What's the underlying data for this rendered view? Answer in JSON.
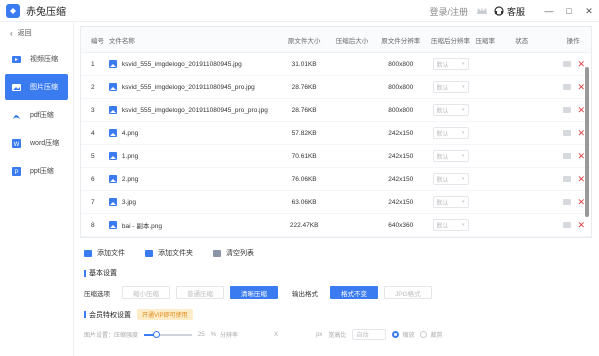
{
  "app": {
    "title": "赤兔压缩",
    "login": "登录/注册",
    "service": "客服"
  },
  "window_buttons": [
    "—",
    "□",
    "✕"
  ],
  "sidebar": {
    "back": "返回",
    "items": [
      {
        "label": "视频压缩",
        "icon": "video-icon"
      },
      {
        "label": "图片压缩",
        "icon": "image-icon",
        "active": true
      },
      {
        "label": "pdf压缩",
        "icon": "pdf-icon"
      },
      {
        "label": "word压缩",
        "icon": "word-icon"
      },
      {
        "label": "ppt压缩",
        "icon": "ppt-icon"
      }
    ]
  },
  "table": {
    "headers": {
      "no": "编号",
      "name": "文件名称",
      "size": "原文件大小",
      "csize": "压缩后大小",
      "res": "原文件分辨率",
      "cres": "压缩后分辨率",
      "ratio": "压缩率",
      "status": "状态",
      "op": "操作"
    },
    "rows": [
      {
        "no": "1",
        "name": "ksvid_555_imgdelogo_201911080945.jpg",
        "size": "31.01KB",
        "res": "800x800",
        "cres": "默认"
      },
      {
        "no": "2",
        "name": "ksvid_555_imgdelogo_201911080945_pro.jpg",
        "size": "28.76KB",
        "res": "800x800",
        "cres": "默认"
      },
      {
        "no": "3",
        "name": "ksvid_555_imgdelogo_201911080945_pro_pro.jpg",
        "size": "28.76KB",
        "res": "800x800",
        "cres": "默认"
      },
      {
        "no": "4",
        "name": "4.png",
        "size": "57.82KB",
        "res": "242x150",
        "cres": "默认"
      },
      {
        "no": "5",
        "name": "1.png",
        "size": "70.61KB",
        "res": "242x150",
        "cres": "默认"
      },
      {
        "no": "6",
        "name": "2.png",
        "size": "76.06KB",
        "res": "242x150",
        "cres": "默认"
      },
      {
        "no": "7",
        "name": "3.jpg",
        "size": "63.06KB",
        "res": "242x150",
        "cres": "默认"
      },
      {
        "no": "8",
        "name": "bai - 副本.png",
        "size": "222.47KB",
        "res": "640x360",
        "cres": "默认"
      }
    ]
  },
  "actions": {
    "add_file": "添加文件",
    "add_folder": "添加文件夹",
    "clear": "清空列表"
  },
  "basic": {
    "title": "基本设置",
    "mode_label": "压缩选项",
    "modes": [
      "缩小压缩",
      "普通压缩",
      "清晰压缩"
    ],
    "format_label": "输出格式",
    "formats": [
      "格式不变",
      "JPG格式"
    ]
  },
  "member": {
    "title": "会员特权设置",
    "badge": "开通VIP即可使用",
    "strength_label": "图片设置：压缩强度",
    "strength_value": "25",
    "strength_unit": "%",
    "strength_level": 0.25,
    "resolution_label": "分辨率",
    "x": "X",
    "px": "px",
    "dpi_label": "宽高比",
    "auto": "自动",
    "radio1": "缩放",
    "radio2": "裁剪"
  },
  "colors": {
    "accent": "#3a7bf0",
    "delete": "#e23b3b"
  }
}
